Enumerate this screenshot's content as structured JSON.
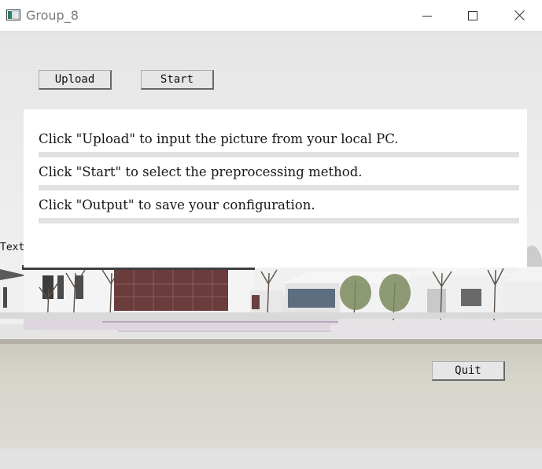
{
  "window": {
    "title": "Group_8",
    "icon": "app-window-icon",
    "controls": [
      "minimize-icon",
      "maximize-icon",
      "close-icon"
    ]
  },
  "toolbar": {
    "upload_label": "Upload",
    "start_label": "Start"
  },
  "instructions": [
    "Click \"Upload\" to input the picture from your local PC.",
    "Click \"Start\" to select the preprocessing method.",
    "Click \"Output\" to save your configuration."
  ],
  "stray_label": "Text",
  "footer": {
    "quit_label": "Quit"
  },
  "background": {
    "scene": "snowy courtyard with white-walled buildings and pond",
    "colors": {
      "sky": "#eeeeee",
      "wall": "#f3f3f3",
      "roof": "#4c4c4c",
      "water": "#cfcfc5",
      "snow": "#e6dde6"
    }
  }
}
